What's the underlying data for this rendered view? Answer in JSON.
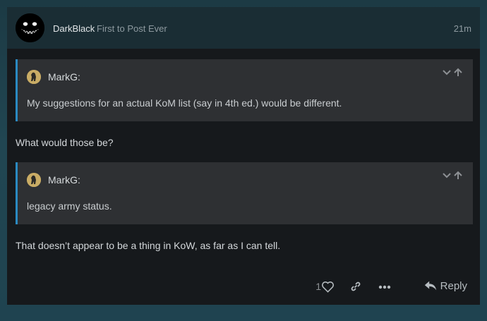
{
  "post": {
    "author": "DarkBlack",
    "user_title": "First to Post Ever",
    "time": "21m",
    "quotes": [
      {
        "name": "MarkG:",
        "text": "My suggestions for an actual KoM list (say in 4th ed.) would be different."
      },
      {
        "name": "MarkG:",
        "text": "legacy army status."
      }
    ],
    "paragraphs": [
      "What would those be?",
      "That doesn’t appear to be a thing in KoW, as far as I can tell."
    ],
    "actions": {
      "like_count": "1",
      "reply_label": "Reply"
    }
  },
  "icons": {
    "avatar": "grinning-face-avatar",
    "quote_avatar": "bigfoot-avatar",
    "quote_controls": [
      "chevron-down-icon",
      "arrow-up-icon"
    ],
    "like": "heart-icon",
    "link": "link-icon",
    "more": "ellipsis-icon",
    "reply": "reply-arrow-icon"
  },
  "colors": {
    "accent": "#2a8ac2",
    "quote_bg": "#2e3033",
    "post_bg": "#16191c"
  }
}
